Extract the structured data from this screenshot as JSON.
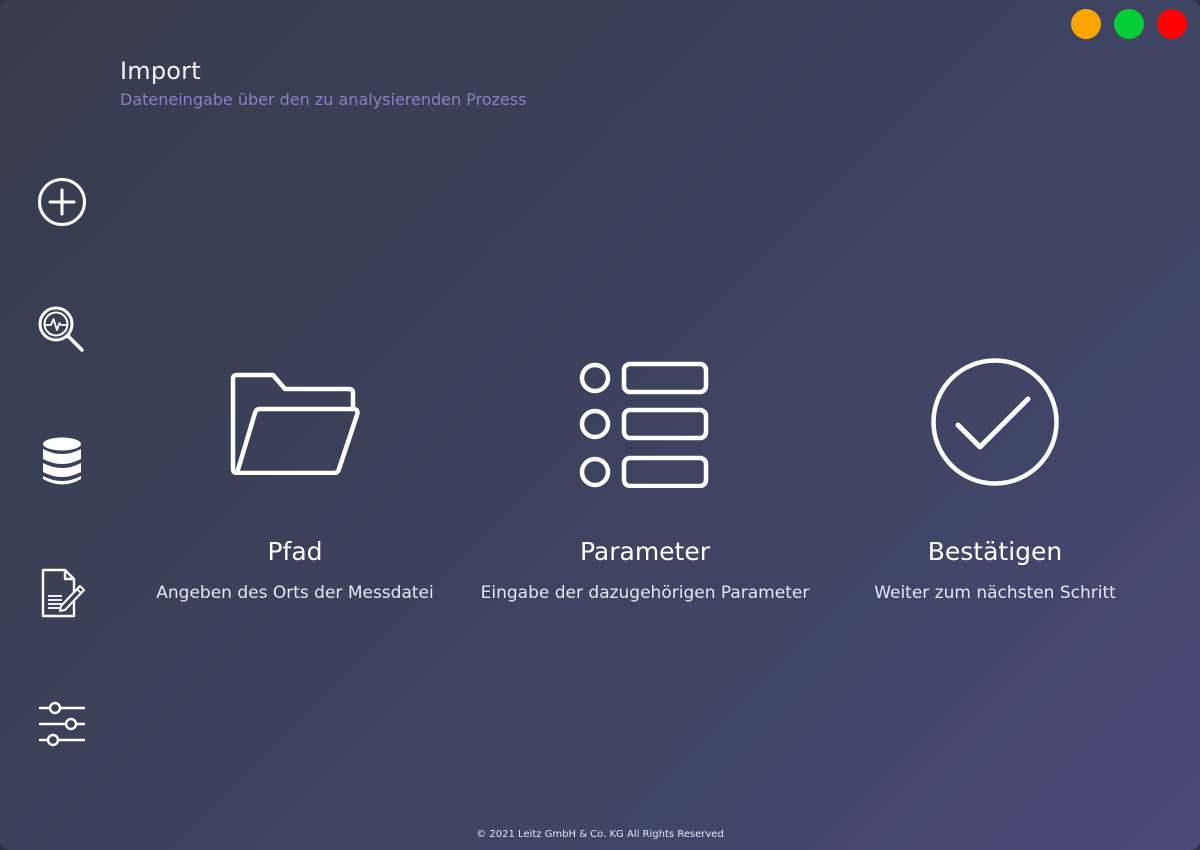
{
  "window": {
    "controls": [
      {
        "name": "minimize",
        "color": "#ffa500"
      },
      {
        "name": "maximize",
        "color": "#00cc33"
      },
      {
        "name": "close",
        "color": "#ff0000"
      }
    ]
  },
  "header": {
    "title": "Import",
    "subtitle": "Dateneingabe über den zu analysierenden Prozess",
    "subtitle_color": "#8a7fc2"
  },
  "sidebar": {
    "items": [
      {
        "icon": "add-circle-icon"
      },
      {
        "icon": "analysis-magnifier-icon"
      },
      {
        "icon": "database-icon"
      },
      {
        "icon": "document-edit-icon"
      },
      {
        "icon": "sliders-icon"
      }
    ]
  },
  "cards": [
    {
      "icon": "folder-icon",
      "title": "Pfad",
      "description": "Angeben des Orts der Messdatei"
    },
    {
      "icon": "parameter-list-icon",
      "title": "Parameter",
      "description": "Eingabe der dazugehörigen Parameter"
    },
    {
      "icon": "check-circle-icon",
      "title": "Bestätigen",
      "description": "Weiter zum nächsten Schritt"
    }
  ],
  "footer": {
    "copyright": "© 2021 Leitz GmbH & Co. KG All Rights Reserved"
  }
}
